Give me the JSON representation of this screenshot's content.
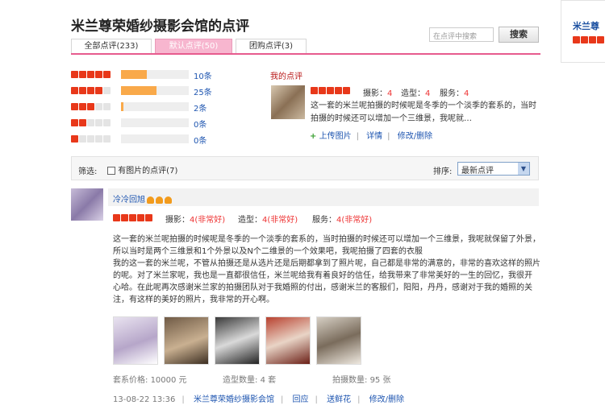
{
  "page": {
    "title": "米兰尊荣婚纱摄影会馆的点评"
  },
  "search": {
    "placeholder": "在点评中搜索",
    "button": "搜索"
  },
  "side": {
    "title": "米兰尊"
  },
  "tabs": [
    {
      "label": "全部点评(233)"
    },
    {
      "label": "默认点评(50)"
    },
    {
      "label": "团购点评(3)"
    }
  ],
  "ratings": [
    {
      "stars": 5,
      "fill": 0.38,
      "count": "10条"
    },
    {
      "stars": 4,
      "fill": 0.52,
      "count": "25条"
    },
    {
      "stars": 3,
      "fill": 0.03,
      "count": "2条"
    },
    {
      "stars": 2,
      "fill": 0,
      "count": "0条"
    },
    {
      "stars": 1,
      "fill": 0,
      "count": "0条"
    }
  ],
  "my_review": {
    "label": "我的点评",
    "stars": 5,
    "dims": [
      {
        "name": "摄影：",
        "score": "4"
      },
      {
        "name": "造型：",
        "score": "4"
      },
      {
        "name": "服务：",
        "score": "4"
      }
    ],
    "text": "这一套的米兰呢拍摄的时候呢是冬季的一个淡季的套系的，当时拍摄的时候还可以增加一个三维景，我呢就…",
    "upload": "上传图片",
    "detail": "详情",
    "edit": "修改/删除"
  },
  "filter": {
    "label": "筛选:",
    "checkbox": "有图片的点评(7)",
    "sort_label": "排序:",
    "sort_value": "最新点评"
  },
  "review": {
    "user": "冷冷回旭",
    "crowns": 3,
    "stars": 5,
    "dims": [
      {
        "name": "摄影：",
        "score": "4",
        "note": "(非常好)"
      },
      {
        "name": "造型：",
        "score": "4",
        "note": "(非常好)"
      },
      {
        "name": "服务：",
        "score": "4",
        "note": "(非常好)"
      }
    ],
    "lines": [
      "这一套的米兰呢拍摄的时候呢是冬季的一个淡季的套系的，当时拍摄的时候还可以增加一个三维景，我呢就保留了外景，",
      "所以当时是两个三维景和1个外景以及N个二维景的一个效果吧，我呢拍摄了四套的衣服",
      "我的这一套的米兰呢，不管从拍摄还是从选片还是后期都拿到了照片呢，自己都是非常的满意的，非常的喜欢这样的照片",
      "的呢。对了米兰家呢，我也是一直都很信任，米兰呢给我有着良好的信任，给我带来了非常美好的一生的回忆，我很开",
      "心哈。在此呢再次感谢米兰家的拍摄团队对于我婚照的付出，感谢米兰的客服们，阳阳，丹丹，感谢对于我的婚照的关",
      "注，有这样的美好的照片，我非常的开心啊。"
    ],
    "price_label": "套系价格:",
    "price": "10000 元",
    "sets_label": "造型数量:",
    "sets": "4 套",
    "count_label": "拍摄数量:",
    "count": "95 张",
    "time": "13-08-22 13:36",
    "shop": "米兰尊荣婚纱摄影会馆",
    "reply": "回应",
    "flower": "送鲜花",
    "edit": "修改/删除"
  },
  "colors": {
    "accent": "#e75b8e",
    "link": "#1e55b0",
    "star": "#e8381a",
    "bar": "#f9a94a",
    "tab_active": "#f7b6cf"
  }
}
